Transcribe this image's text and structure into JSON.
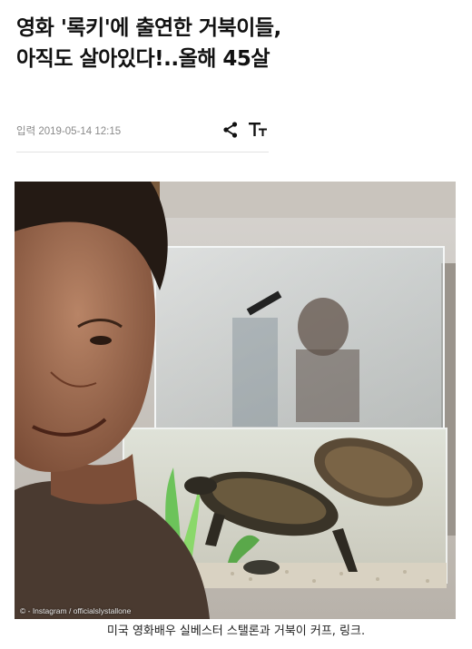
{
  "article": {
    "headline": "영화 '록키'에 출연한 거북이들, 아직도 살아있다!..올해 45살",
    "date_prefix": "입력",
    "date": "2019-05-14 12:15",
    "icons": {
      "share": "share-icon",
      "text_size": "text-size-icon"
    }
  },
  "photo": {
    "credit": "© - Instagram / officialslystallone",
    "caption": "미국 영화배우 실베스터 스탤론과 거북이 커프, 링크."
  },
  "colors": {
    "meta_text": "#8a8a8a",
    "divider": "#e2e2e2",
    "headline": "#111111"
  }
}
